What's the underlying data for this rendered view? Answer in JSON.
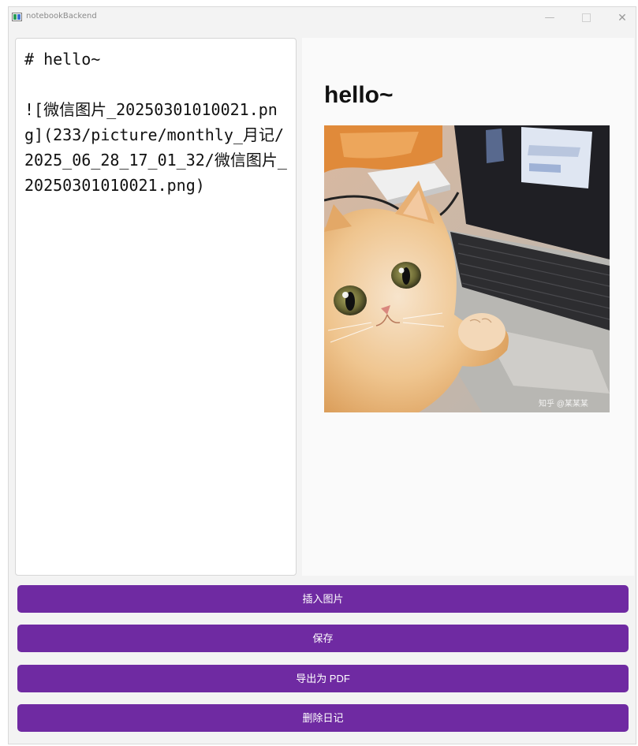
{
  "window": {
    "title": "notebookBackend",
    "minimize_glyph": "—",
    "close_glyph": "✕"
  },
  "editor": {
    "content": "# hello~\n\n![微信图片_20250301010021.png](233/picture/monthly_月记/2025_06_28_17_01_32/微信图片_20250301010021.png)"
  },
  "preview": {
    "heading": "hello~",
    "image_alt": "微信图片_20250301010021.png",
    "image_icon": "cat-photo",
    "watermark": "知乎 @某某某"
  },
  "buttons": {
    "insert_image": "插入图片",
    "save": "保存",
    "export_pdf": "导出为 PDF",
    "delete_diary": "删除日记"
  },
  "colors": {
    "button_bg": "#6f2aa2",
    "button_text": "#ffffff",
    "window_bg": "#f3f3f3",
    "preview_bg": "#fafafa"
  }
}
